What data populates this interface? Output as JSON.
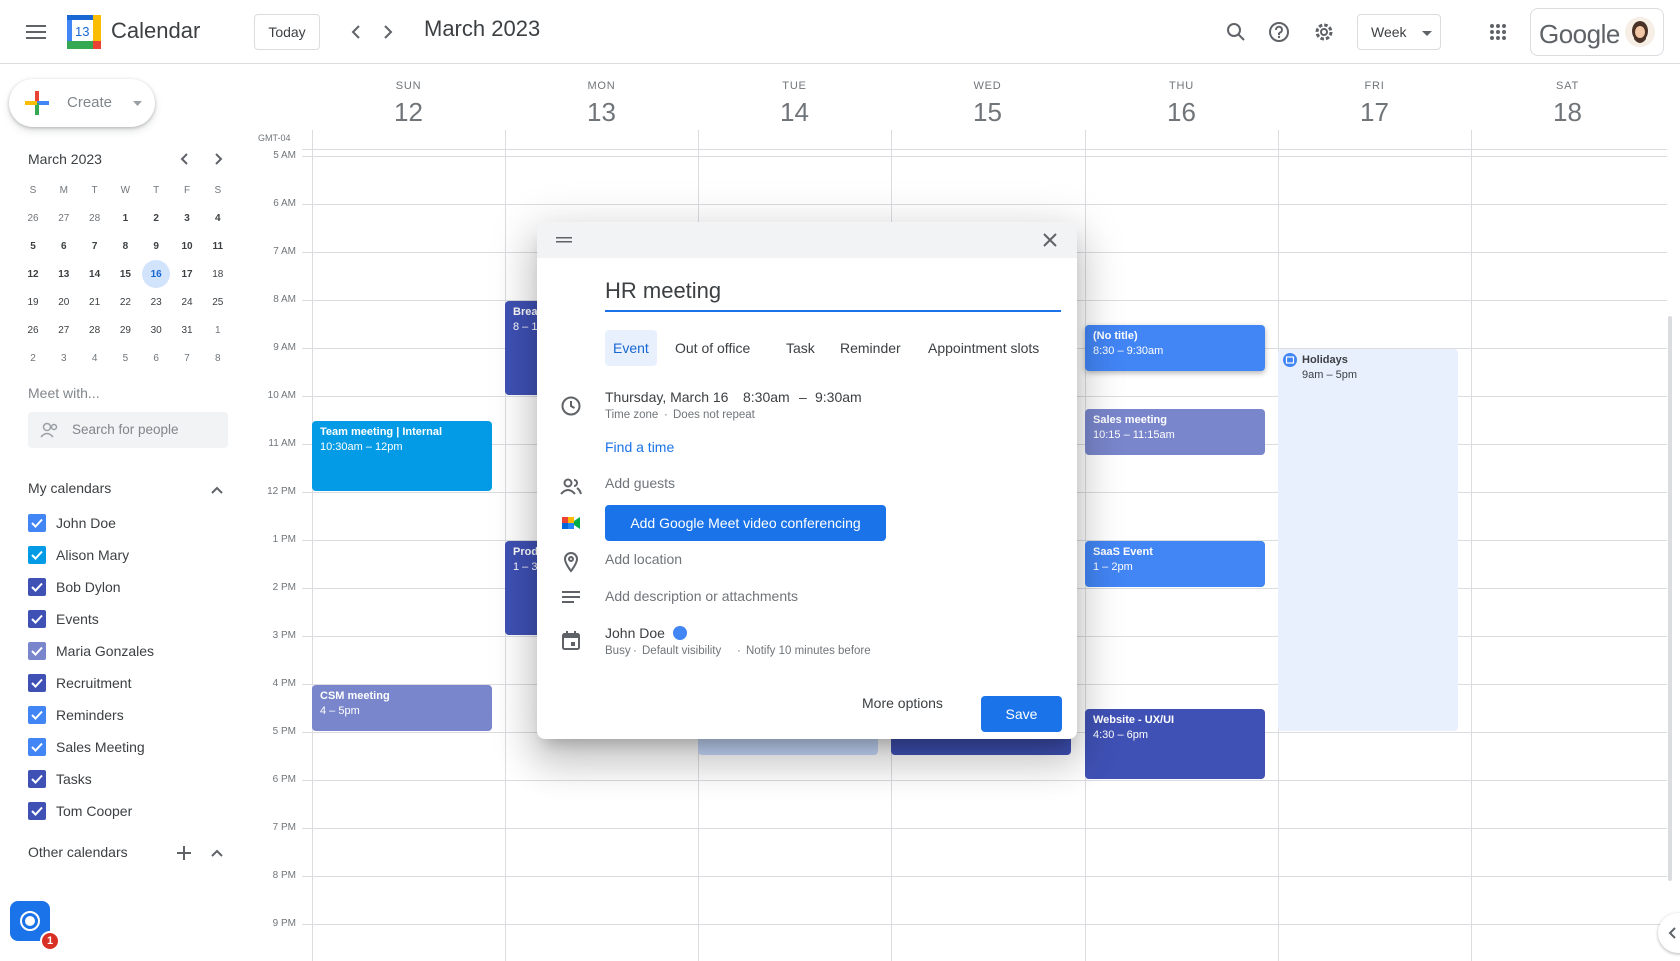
{
  "header": {
    "app_title": "Calendar",
    "logo_number": "13",
    "today_label": "Today",
    "month_title": "March 2023",
    "view_label": "Week",
    "brand_label": "Google"
  },
  "sidebar": {
    "create_label": "Create",
    "mini_month_title": "March 2023",
    "mini_dow": [
      "S",
      "M",
      "T",
      "W",
      "T",
      "F",
      "S"
    ],
    "mini_weeks": [
      [
        "26",
        "27",
        "28",
        "1",
        "2",
        "3",
        "4"
      ],
      [
        "5",
        "6",
        "7",
        "8",
        "9",
        "10",
        "11"
      ],
      [
        "12",
        "13",
        "14",
        "15",
        "16",
        "17",
        "18"
      ],
      [
        "19",
        "20",
        "21",
        "22",
        "23",
        "24",
        "25"
      ],
      [
        "26",
        "27",
        "28",
        "29",
        "30",
        "31",
        "1"
      ],
      [
        "2",
        "3",
        "4",
        "5",
        "6",
        "7",
        "8"
      ]
    ],
    "meet_title": "Meet with...",
    "search_people_placeholder": "Search for people",
    "my_calendars_title": "My calendars",
    "my_calendars": [
      {
        "label": "John Doe",
        "color": "#4285f4"
      },
      {
        "label": "Alison Mary",
        "color": "#039be5"
      },
      {
        "label": "Bob Dylon",
        "color": "#3f51b5"
      },
      {
        "label": "Events",
        "color": "#3f51b5"
      },
      {
        "label": "Maria Gonzales",
        "color": "#7986cb"
      },
      {
        "label": "Recruitment",
        "color": "#3f51b5"
      },
      {
        "label": "Reminders",
        "color": "#4285f4"
      },
      {
        "label": "Sales Meeting",
        "color": "#4285f4"
      },
      {
        "label": "Tasks",
        "color": "#3f51b5"
      },
      {
        "label": "Tom Cooper",
        "color": "#3f51b5"
      }
    ],
    "other_calendars_title": "Other calendars",
    "notification_count": "1"
  },
  "grid": {
    "timezone": "GMT-04",
    "days": [
      {
        "dow": "SUN",
        "num": "12"
      },
      {
        "dow": "MON",
        "num": "13"
      },
      {
        "dow": "TUE",
        "num": "14"
      },
      {
        "dow": "WED",
        "num": "15"
      },
      {
        "dow": "THU",
        "num": "16"
      },
      {
        "dow": "FRI",
        "num": "17"
      },
      {
        "dow": "SAT",
        "num": "18"
      }
    ],
    "hours": [
      "5 AM",
      "6 AM",
      "7 AM",
      "8 AM",
      "9 AM",
      "10 AM",
      "11 AM",
      "12 PM",
      "1 PM",
      "2 PM",
      "3 PM",
      "4 PM",
      "5 PM",
      "6 PM",
      "7 PM",
      "8 PM",
      "9 PM"
    ],
    "events": {
      "team_meeting": {
        "title": "Team meeting | Internal",
        "time": "10:30am – 12pm",
        "color": "#039be5"
      },
      "csm_meeting": {
        "title": "CSM meeting",
        "time": "4 – 5pm",
        "color": "#7986cb"
      },
      "breakfast": {
        "title": "Brea",
        "time": "8 – 1",
        "color": "#3f51b5"
      },
      "product": {
        "title": "Prod",
        "time": "1 – 3",
        "color": "#3f51b5"
      },
      "no_title": {
        "title": "(No title)",
        "time": "8:30 – 9:30am",
        "color": "#4285f4"
      },
      "sales_meeting": {
        "title": "Sales meeting",
        "time": "10:15 – 11:15am",
        "color": "#7986cb"
      },
      "saas_event": {
        "title": "SaaS Event",
        "time": "1 – 2pm",
        "color": "#4285f4"
      },
      "website": {
        "title": "Website - UX/UI",
        "time": "4:30 – 6pm",
        "color": "#3f51b5"
      },
      "holidays": {
        "title": "Holidays",
        "time": "9am – 5pm",
        "color": "#e8f0fe"
      }
    }
  },
  "dialog": {
    "title_value": "HR meeting",
    "tabs": [
      "Event",
      "Out of office",
      "Task",
      "Reminder",
      "Appointment slots"
    ],
    "date_label": "Thursday, March 16",
    "start_time": "8:30am",
    "dash": "–",
    "end_time": "9:30am",
    "time_zone_label": "Time zone",
    "repeat_label": "Does not repeat",
    "find_time_label": "Find a time",
    "add_guests_label": "Add guests",
    "meet_button_label": "Add Google Meet video conferencing",
    "add_location_label": "Add location",
    "add_description_label": "Add description or attachments",
    "calendar_owner": "John Doe",
    "calendar_color": "#4285f4",
    "busy_label": "Busy",
    "visibility_label": "Default visibility",
    "notify_label": "Notify 10 minutes before",
    "more_options_label": "More options",
    "save_label": "Save"
  }
}
